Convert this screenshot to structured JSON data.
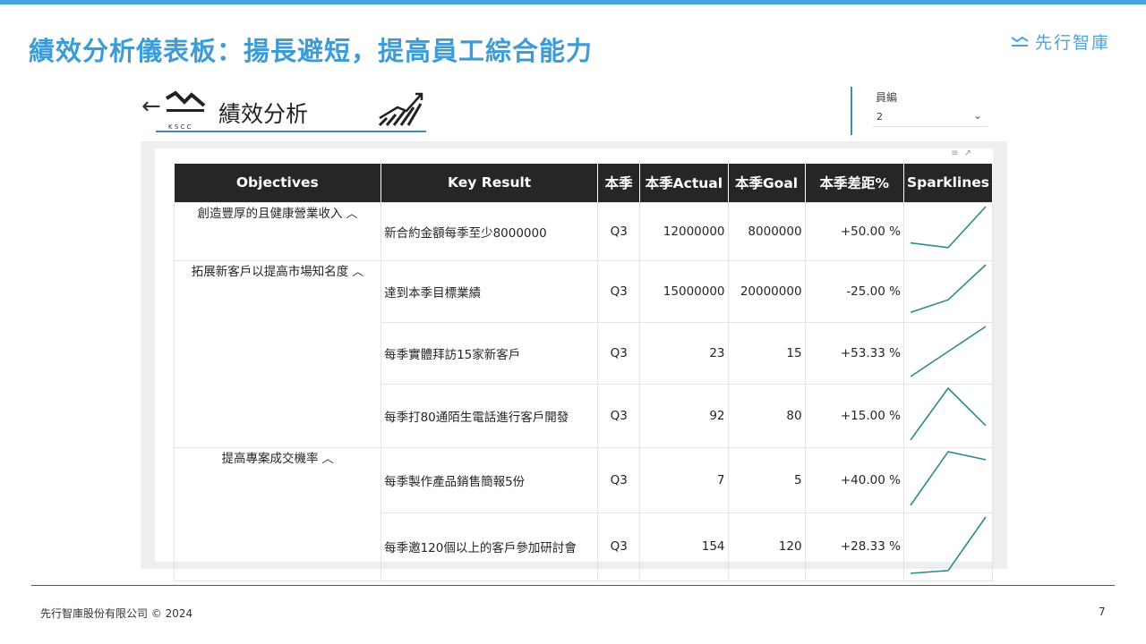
{
  "slide": {
    "title": "績效分析儀表板：揚長避短，提高員工綜合能力",
    "brand": "先行智庫",
    "footer": "先行智庫股份有限公司 © 2024",
    "page": "7"
  },
  "report": {
    "title": "績效分析",
    "logo_text": "K S C C",
    "back_icon": "back-arrow-icon",
    "growth_icon": "growth-chart-icon"
  },
  "slicer": {
    "label": "員編",
    "value": "2"
  },
  "colors": {
    "accent": "#3d9bd6",
    "header_bg": "#262626",
    "sparkline": "#2e8b8b"
  },
  "table": {
    "columns": [
      "Objectives",
      "Key Result",
      "本季",
      "本季Actual",
      "本季Goal",
      "本季差距%",
      "Sparklines"
    ],
    "objectives": [
      "創造豐厚的且健康營業收入",
      "拓展新客戶以提高市場知名度",
      "提高專案成交機率"
    ],
    "rows": [
      {
        "kr": "新合約金額每季至少8000000",
        "quarter": "Q3",
        "actual": "12000000",
        "goal": "8000000",
        "gap": "+50.00 %",
        "spark": [
          0.22,
          0.12,
          1.0
        ]
      },
      {
        "kr": "達到本季目標業績",
        "quarter": "Q3",
        "actual": "15000000",
        "goal": "20000000",
        "gap": "-25.00 %",
        "spark": [
          0.05,
          0.3,
          1.0
        ]
      },
      {
        "kr": "每季實體拜訪15家新客戶",
        "quarter": "Q3",
        "actual": "23",
        "goal": "15",
        "gap": "+53.33 %",
        "spark": [
          0.0,
          0.5,
          1.0
        ]
      },
      {
        "kr": "每季打80通陌生電話進行客戶開發",
        "quarter": "Q3",
        "actual": "92",
        "goal": "80",
        "gap": "+15.00 %",
        "spark": [
          0.0,
          1.0,
          0.28
        ]
      },
      {
        "kr": "每季製作產品銷售簡報5份",
        "quarter": "Q3",
        "actual": "7",
        "goal": "5",
        "gap": "+40.00 %",
        "spark": [
          0.0,
          1.0,
          0.85
        ]
      },
      {
        "kr": "每季邀120個以上的客戶參加研討會",
        "quarter": "Q3",
        "actual": "154",
        "goal": "120",
        "gap": "+28.33 %",
        "spark": [
          0.0,
          0.05,
          1.0
        ]
      }
    ]
  }
}
